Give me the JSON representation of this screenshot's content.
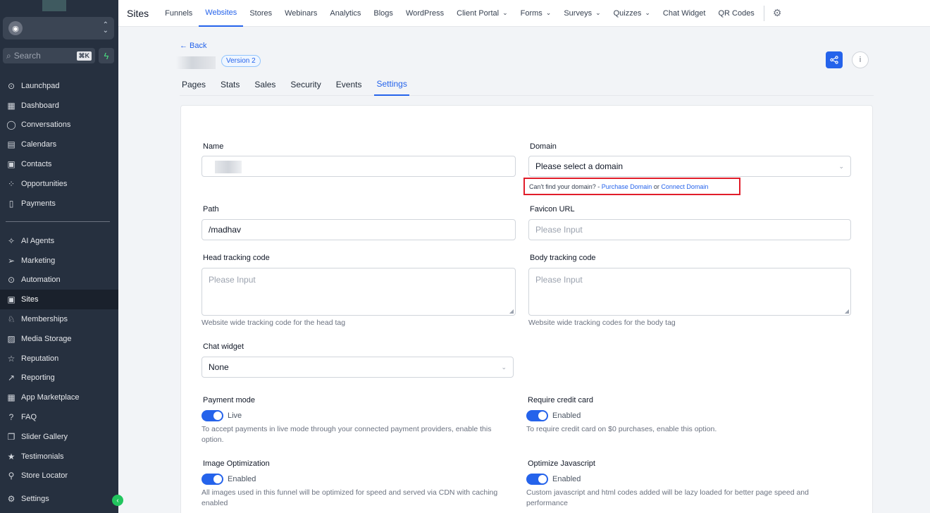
{
  "sidebar": {
    "search_placeholder": "Search",
    "search_shortcut": "⌘K",
    "items_top": [
      {
        "label": "Launchpad",
        "icon": "rocket-icon",
        "glyph": "⊙"
      },
      {
        "label": "Dashboard",
        "icon": "dashboard-icon",
        "glyph": "▦"
      },
      {
        "label": "Conversations",
        "icon": "chat-icon",
        "glyph": "◯"
      },
      {
        "label": "Calendars",
        "icon": "calendar-icon",
        "glyph": "▤"
      },
      {
        "label": "Contacts",
        "icon": "contacts-icon",
        "glyph": "▣"
      },
      {
        "label": "Opportunities",
        "icon": "opportunities-icon",
        "glyph": "⁘"
      },
      {
        "label": "Payments",
        "icon": "payments-icon",
        "glyph": "▯"
      }
    ],
    "items_bottom": [
      {
        "label": "AI Agents",
        "icon": "ai-agents-icon",
        "glyph": "✧"
      },
      {
        "label": "Marketing",
        "icon": "send-icon",
        "glyph": "➢"
      },
      {
        "label": "Automation",
        "icon": "automation-icon",
        "glyph": "⊙"
      },
      {
        "label": "Sites",
        "icon": "sites-icon",
        "glyph": "▣",
        "active": true
      },
      {
        "label": "Memberships",
        "icon": "memberships-icon",
        "glyph": "♘"
      },
      {
        "label": "Media Storage",
        "icon": "media-icon",
        "glyph": "▨"
      },
      {
        "label": "Reputation",
        "icon": "star-icon",
        "glyph": "☆"
      },
      {
        "label": "Reporting",
        "icon": "trend-icon",
        "glyph": "↗"
      },
      {
        "label": "App Marketplace",
        "icon": "apps-icon",
        "glyph": "▦"
      },
      {
        "label": "FAQ",
        "icon": "question-icon",
        "glyph": "?"
      },
      {
        "label": "Slider Gallery",
        "icon": "gallery-icon",
        "glyph": "❐"
      },
      {
        "label": "Testimonials",
        "icon": "testimonials-icon",
        "glyph": "★"
      },
      {
        "label": "Store Locator",
        "icon": "location-pin-icon",
        "glyph": "⚲"
      }
    ],
    "settings_label": "Settings"
  },
  "topnav": {
    "section_title": "Sites",
    "items": [
      {
        "label": "Funnels"
      },
      {
        "label": "Websites",
        "active": true
      },
      {
        "label": "Stores"
      },
      {
        "label": "Webinars"
      },
      {
        "label": "Analytics"
      },
      {
        "label": "Blogs"
      },
      {
        "label": "WordPress"
      },
      {
        "label": "Client Portal",
        "dropdown": true
      },
      {
        "label": "Forms",
        "dropdown": true
      },
      {
        "label": "Surveys",
        "dropdown": true
      },
      {
        "label": "Quizzes",
        "dropdown": true
      },
      {
        "label": "Chat Widget"
      },
      {
        "label": "QR Codes"
      }
    ]
  },
  "header": {
    "back_label": "← Back",
    "version_badge": "Version 2"
  },
  "tabs": [
    {
      "label": "Pages"
    },
    {
      "label": "Stats"
    },
    {
      "label": "Sales"
    },
    {
      "label": "Security"
    },
    {
      "label": "Events"
    },
    {
      "label": "Settings",
      "active": true
    }
  ],
  "form": {
    "name_label": "Name",
    "domain_label": "Domain",
    "domain_placeholder": "Please select a domain",
    "domain_hint_prefix": "Can't find your domain? - ",
    "purchase_domain": "Purchase Domain",
    "domain_hint_or": " or ",
    "connect_domain": "Connect Domain",
    "path_label": "Path",
    "path_value": "/madhav",
    "favicon_label": "Favicon URL",
    "favicon_placeholder": "Please Input",
    "head_label": "Head tracking code",
    "head_placeholder": "Please Input",
    "head_help": "Website wide tracking code for the head tag",
    "body_label": "Body tracking code",
    "body_placeholder": "Please Input",
    "body_help": "Website wide tracking codes for the body tag",
    "chat_label": "Chat widget",
    "chat_value": "None",
    "payment_label": "Payment mode",
    "payment_state": "Live",
    "payment_help": "To accept payments in live mode through your connected payment providers, enable this option.",
    "credit_label": "Require credit card",
    "credit_state": "Enabled",
    "credit_help": "To require credit card on $0 purchases, enable this option.",
    "image_label": "Image Optimization",
    "image_state": "Enabled",
    "image_help": "All images used in this funnel will be optimized for speed and served via CDN with caching enabled",
    "js_label": "Optimize Javascript",
    "js_state": "Enabled",
    "js_help": "Custom javascript and html codes added will be lazy loaded for better page speed and performance"
  },
  "colors": {
    "accent": "#2563eb",
    "sidebar_bg": "#26303f",
    "highlight_box": "#e11d2a"
  }
}
